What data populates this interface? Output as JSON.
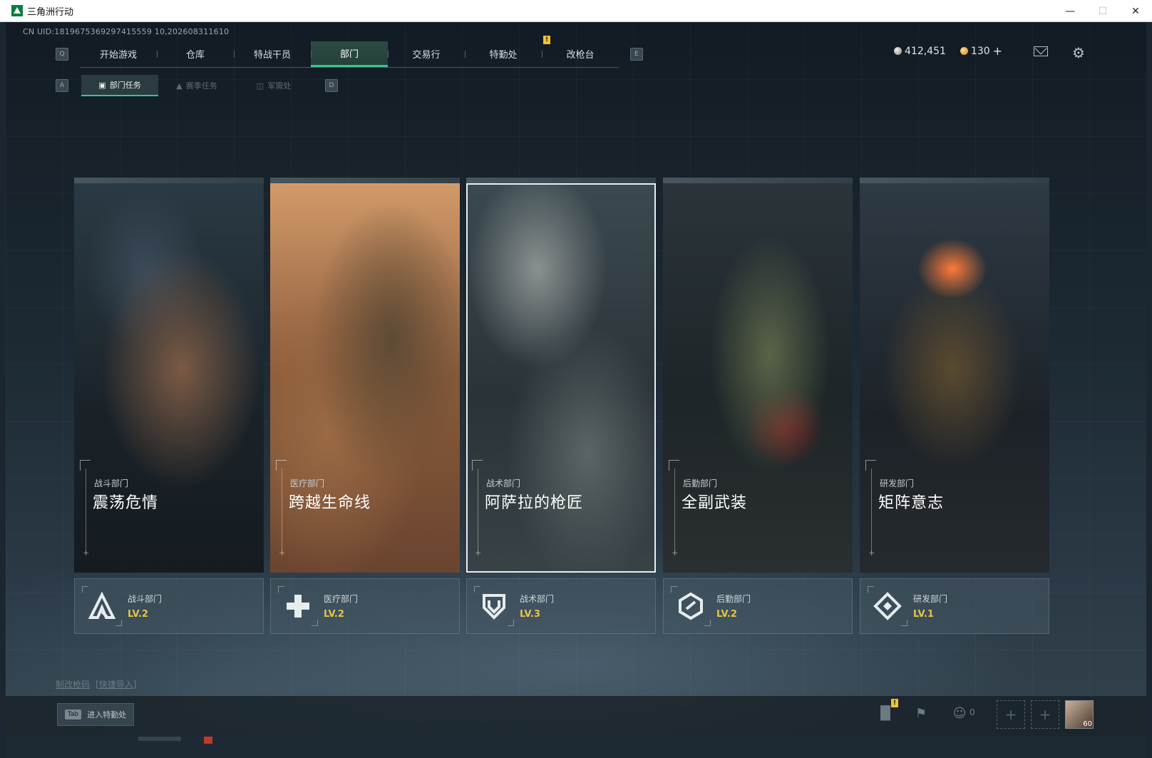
{
  "window": {
    "title": "三角洲行动"
  },
  "uid_text": "CN UID:1819675369297415559 10,202608311610",
  "nav": {
    "key_left": "Q",
    "key_right": "E",
    "tabs": [
      {
        "label": "开始游戏"
      },
      {
        "label": "仓库"
      },
      {
        "label": "特战干员"
      },
      {
        "label": "部门",
        "active": true
      },
      {
        "label": "交易行"
      },
      {
        "label": "特勤处",
        "badge": "!"
      },
      {
        "label": "改枪台"
      }
    ]
  },
  "subnav": {
    "key_left": "A",
    "key_right": "D",
    "tabs": [
      {
        "label": "部门任务",
        "active": true
      },
      {
        "label": "赛季任务"
      },
      {
        "label": "军需处"
      }
    ]
  },
  "currency": {
    "silver": "412,451",
    "gold": "130",
    "plus": "+"
  },
  "cards": [
    {
      "department": "战斗部门",
      "title": "震荡危情",
      "level": "LV.2",
      "icon": "combat-icon"
    },
    {
      "department": "医疗部门",
      "title": "跨越生命线",
      "level": "LV.2",
      "icon": "medical-cross-icon"
    },
    {
      "department": "战术部门",
      "title": "阿萨拉的枪匠",
      "level": "LV.3",
      "icon": "shield-icon"
    },
    {
      "department": "后勤部门",
      "title": "全副武装",
      "level": "LV.2",
      "icon": "hexagon-icon"
    },
    {
      "department": "研发部门",
      "title": "矩阵意志",
      "level": "LV.1",
      "icon": "diamond-icon"
    }
  ],
  "links": {
    "gunsmith_code": "制改枪码",
    "quick_import": "[快捷导入]"
  },
  "bottom": {
    "tab_key": "Tab",
    "tab_label": "进入特勤处",
    "stats_badge": "!",
    "friends_count": "0",
    "avatar_level": "60"
  },
  "colors": {
    "accent_green": "#39c48c",
    "level_gold": "#e8c447",
    "badge_yellow": "#f1c232"
  }
}
